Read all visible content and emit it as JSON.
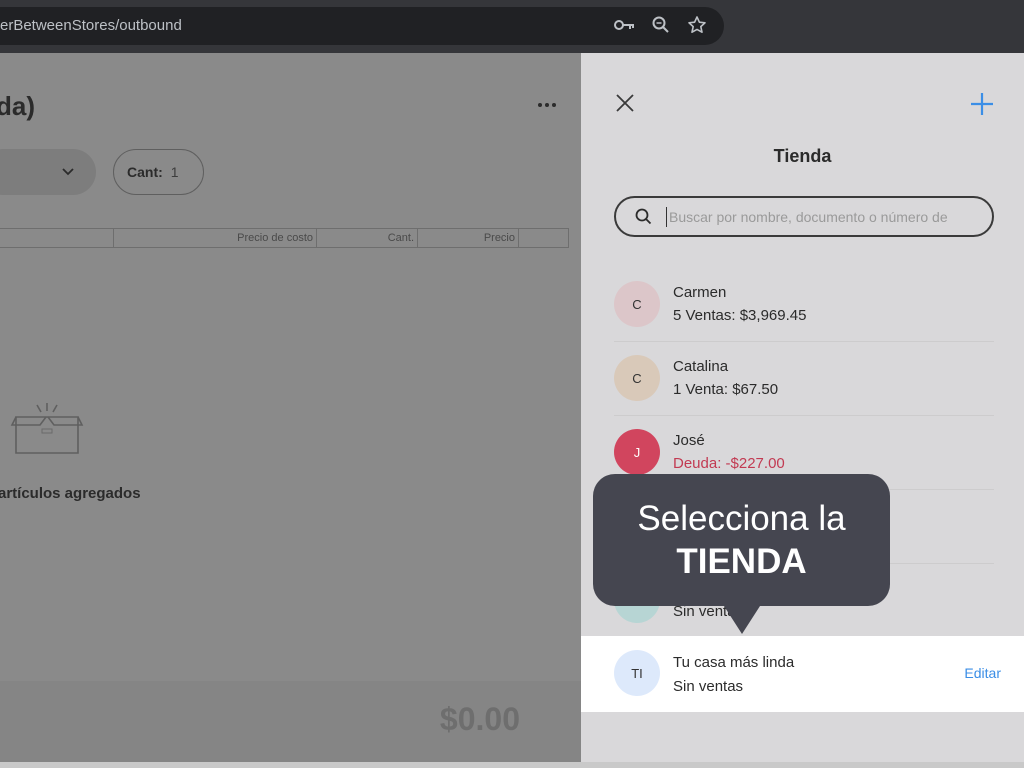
{
  "browser": {
    "url": "erBetweenStores/outbound",
    "icons": [
      "key-icon",
      "zoom-icon",
      "star-icon"
    ]
  },
  "page": {
    "title": "da)",
    "quantity_label": "Cant:",
    "quantity_value": "1",
    "table_headers": [
      "",
      "Precio de costo",
      "Cant.",
      "Precio",
      ""
    ],
    "empty_message": "artículos agregados",
    "total": "$0.00"
  },
  "drawer": {
    "title": "Tienda",
    "search_placeholder": "Buscar por nombre, documento o número de",
    "clients": [
      {
        "initials": "C",
        "name": "Carmen",
        "info": "5 Ventas: $3,969.45",
        "avatar_color": "#dcc6c9",
        "debt": false
      },
      {
        "initials": "C",
        "name": "Catalina",
        "info": "1 Venta: $67.50",
        "avatar_color": "#d9c9b9",
        "debt": false
      },
      {
        "initials": "J",
        "name": "José",
        "info": "Deuda: -$227.00",
        "avatar_color": "#d1455e",
        "debt": true
      },
      {
        "initials": "",
        "name": "",
        "info": "",
        "avatar_color": "#d9d8da",
        "debt": false
      },
      {
        "initials": "",
        "name": "",
        "info": "Sin ventas",
        "avatar_color": "#b7d5d4",
        "debt": false
      }
    ],
    "selected_client": {
      "initials": "TI",
      "name": "Tu casa más linda",
      "info": "Sin ventas",
      "action": "Editar"
    }
  },
  "tooltip": {
    "line1": "Selecciona la",
    "line2": "TIENDA"
  }
}
